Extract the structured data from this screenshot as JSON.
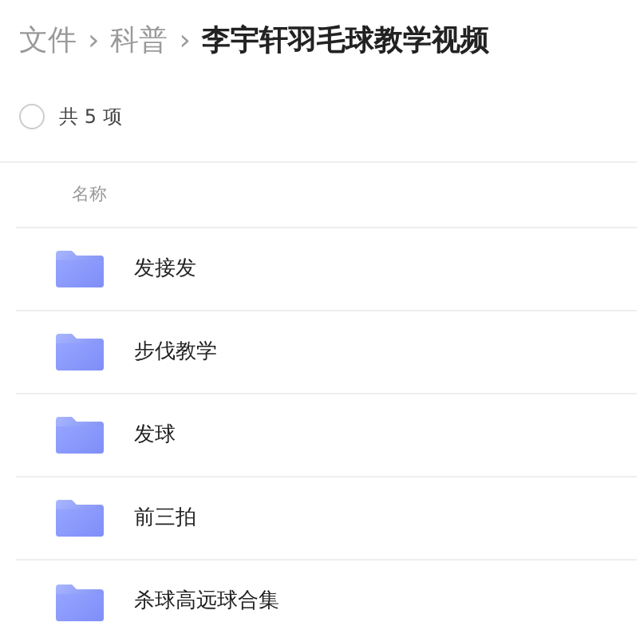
{
  "breadcrumb": [
    {
      "label": "文件",
      "current": false
    },
    {
      "label": "科普",
      "current": false,
      "separator": "›"
    },
    {
      "label": "李宇轩羽毛球教学视频",
      "current": true,
      "separator": "›"
    }
  ],
  "select_all": {
    "checked": false
  },
  "count": "共 5 项",
  "columns": [
    "名称"
  ],
  "items": [
    {
      "name": "发接发",
      "kind": "folder"
    },
    {
      "name": "步伐教学",
      "kind": "folder"
    },
    {
      "name": "发球",
      "kind": "folder"
    },
    {
      "name": "前三拍",
      "kind": "folder"
    },
    {
      "name": "杀球高远球合集",
      "kind": "folder"
    }
  ]
}
